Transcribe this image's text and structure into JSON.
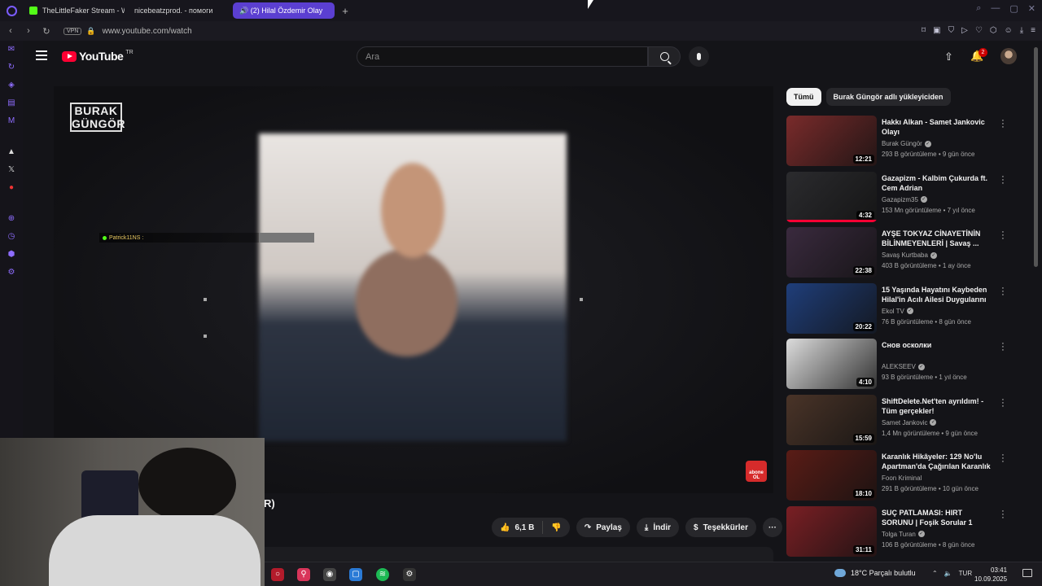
{
  "browser": {
    "tabs": [
      {
        "label": "TheLittleFaker Stream - W",
        "icon": "kick"
      },
      {
        "label": "nicebeatzprod. - помоги",
        "icon": "youtube"
      },
      {
        "label": "🔊 (2) Hilal Özdemir Olay",
        "icon": "youtube",
        "active": true
      }
    ],
    "vpn_label": "VPN",
    "url": "www.youtube.com/watch"
  },
  "youtube": {
    "logo_text": "YouTube",
    "region": "TR",
    "search_placeholder": "Ara",
    "notification_count": "2"
  },
  "player": {
    "channel_logo_text": "BURAK GÜNGÖR",
    "chat_user": "Patrick11NS :",
    "subscribe_badge": "abone OL",
    "title_fragment": "R)"
  },
  "actions": {
    "likes": "6,1 B",
    "share": "Paylaş",
    "download": "İndir",
    "thanks": "Teşekkürler",
    "more": "···"
  },
  "filters": [
    {
      "label": "Tümü",
      "selected": true
    },
    {
      "label": "Burak Güngör adlı yükleyiciden",
      "selected": false
    }
  ],
  "recommendations": [
    {
      "title": "Hakkı Alkan - Samet Jankovic Olayı",
      "channel": "Burak Güngör",
      "verified": true,
      "meta": "293 B görüntüleme • 9 gün önce",
      "duration": "12:21",
      "thumb_color": "#7a2b2b",
      "progress": 0
    },
    {
      "title": "Gazapizm - Kalbim Çukurda ft. Cem Adrian",
      "channel": "Gazapizm35",
      "verified": true,
      "meta": "153 Mn görüntüleme • 7 yıl önce",
      "duration": "4:32",
      "thumb_color": "#2b2b2e",
      "progress": 100
    },
    {
      "title": "AYŞE TOKYAZ CİNAYETİNİN BİLİNMEYENLERİ | Savaş ...",
      "channel": "Savaş Kurtbaba",
      "verified": true,
      "meta": "403 B görüntüleme • 1 ay önce",
      "duration": "22:38",
      "thumb_color": "#3a2a3e",
      "progress": 0
    },
    {
      "title": "15 Yaşında Hayatını Kaybeden Hilal'in Acılı Ailesi Duygularını ...",
      "channel": "Ekol TV",
      "verified": true,
      "meta": "76 B görüntüleme • 8 gün önce",
      "duration": "20:22",
      "thumb_color": "#1f3e7a",
      "progress": 0
    },
    {
      "title": "Снов осколки",
      "channel": "ALEKSEEV",
      "verified": true,
      "meta": "93 B görüntüleme • 1 yıl önce",
      "duration": "4:10",
      "thumb_color": "#dcdcdc",
      "progress": 0
    },
    {
      "title": "ShiftDelete.Net'ten ayrıldım! - Tüm gerçekler!",
      "channel": "Samet Jankovic",
      "verified": true,
      "meta": "1,4 Mn görüntüleme • 9 gün önce",
      "duration": "15:59",
      "thumb_color": "#4a3428",
      "progress": 0
    },
    {
      "title": "Karanlık Hikâyeler: 129 No'lu Apartman'da Çağırılan Karanlık",
      "channel": "Foon Kriminal",
      "verified": false,
      "meta": "291 B görüntüleme • 10 gün önce",
      "duration": "18:10",
      "thumb_color": "#5a1c16",
      "progress": 0
    },
    {
      "title": "SUÇ PATLAMASI: HIRT SORUNU | Foşik Sorular 1",
      "channel": "Tolga Turan",
      "verified": true,
      "meta": "106 B görüntüleme • 8 gün önce",
      "duration": "31:11",
      "thumb_color": "#7a1f24",
      "progress": 0
    }
  ],
  "taskbar": {
    "weather": "18°C  Parçalı bulutlu",
    "lang": "TUR",
    "time": "03:41",
    "date": "10.09.2025"
  }
}
